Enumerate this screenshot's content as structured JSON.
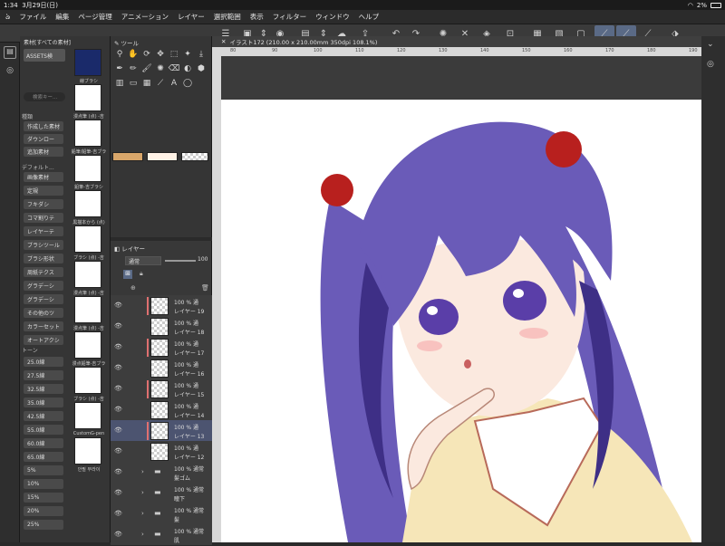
{
  "status": {
    "time": "1:34",
    "date": "3月29日(日)",
    "battery": "2%"
  },
  "menu": [
    "ファイル",
    "編集",
    "ページ管理",
    "アニメーション",
    "レイヤー",
    "選択範囲",
    "表示",
    "フィルター",
    "ウィンドウ",
    "ヘルプ"
  ],
  "material": {
    "title": "素材[すべての素材]",
    "assets": "ASSETS検",
    "search_placeholder": "検索キー...",
    "type_header": "種類",
    "default_header": "デフォルト...",
    "tone_header": "トーン",
    "type_items": [
      "作成した素材",
      "ダウンロー",
      "追加素材"
    ],
    "default_items": [
      "画像素材",
      "定規",
      "フキダシ",
      "コマ割りテ",
      "レイヤーテ",
      "ブラシツール",
      "ブラシ形状",
      "周紙テクス",
      "グラデーシ",
      "グラデーシ",
      "その他のツ",
      "カラーセット",
      "オートアクシ"
    ],
    "tone_items": [
      "25.0線",
      "27.5線",
      "32.5線",
      "35.0線",
      "42.5線",
      "55.0線",
      "60.0線",
      "65.0線",
      "5%",
      "10%",
      "15%",
      "20%",
      "25%"
    ],
    "thumbs": [
      "線ブラシ",
      "漫点筆 (点) -吉",
      "鉛筆/鉛筆-吉ブラ",
      "鉛筆-吉ブラシ",
      "黒描本から (点)",
      "ブラシ (点) -吉",
      "漫点筆 (点) -吉",
      "漫点筆 (点) -吉",
      "漫点鉛筆-吉ブラ",
      "ブラシ (点) -吉",
      "CustomG-pen",
      "안필 부라이"
    ]
  },
  "tools": {
    "title": "ツール"
  },
  "layers": {
    "title": "レイヤー",
    "blend": "通常",
    "opacity": "100",
    "items": [
      {
        "mode": "100 % 通",
        "name": "レイヤー 19",
        "red": true,
        "sel": false
      },
      {
        "mode": "100 % 通",
        "name": "レイヤー 18",
        "red": false,
        "sel": false
      },
      {
        "mode": "100 % 通",
        "name": "レイヤー 17",
        "red": true,
        "sel": false
      },
      {
        "mode": "100 % 通",
        "name": "レイヤー 16",
        "red": false,
        "sel": false
      },
      {
        "mode": "100 % 通",
        "name": "レイヤー 15",
        "red": true,
        "sel": false
      },
      {
        "mode": "100 % 通",
        "name": "レイヤー 14",
        "red": false,
        "sel": false
      },
      {
        "mode": "100 % 通",
        "name": "レイヤー 13",
        "red": true,
        "sel": true
      },
      {
        "mode": "100 % 通",
        "name": "レイヤー 12",
        "red": false,
        "sel": false
      }
    ],
    "folders": [
      {
        "mode": "100 % 通常",
        "name": "髪ゴム"
      },
      {
        "mode": "100 % 通常",
        "name": "瞳下"
      },
      {
        "mode": "100 % 通常",
        "name": "髪"
      },
      {
        "mode": "100 % 通常",
        "name": "肌"
      }
    ]
  },
  "canvas": {
    "title": "イラスト172 (210.00 x 210.00mm 350dpi 108.1%)",
    "ruler": [
      "80",
      "90",
      "100",
      "110",
      "120",
      "130",
      "140",
      "150",
      "160",
      "170",
      "180",
      "190"
    ]
  },
  "colors": {
    "hair": "#6a5bb8",
    "hair_dark": "#3e2f86",
    "ribbon": "#b8201e",
    "skin": "#fbe9df",
    "shirt": "#f6e6b8"
  }
}
